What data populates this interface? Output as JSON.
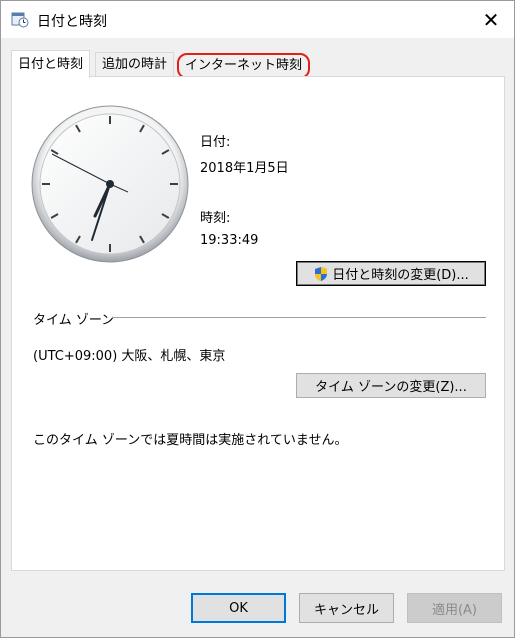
{
  "window": {
    "title": "日付と時刻",
    "close_glyph": "✕"
  },
  "tabs": [
    {
      "label": "日付と時刻",
      "active": true
    },
    {
      "label": "追加の時計",
      "active": false
    },
    {
      "label": "インターネット時刻",
      "active": false,
      "highlighted": true
    }
  ],
  "date_time": {
    "date_label": "日付:",
    "date_value": "2018年1月5日",
    "time_label": "時刻:",
    "time_value": "19:33:49",
    "change_button": "日付と時刻の変更(D)..."
  },
  "timezone": {
    "section_label": "タイム ゾーン",
    "value": "(UTC+09:00) 大阪、札幌、東京",
    "change_button": "タイム ゾーンの変更(Z)...",
    "dst_note": "このタイム ゾーンでは夏時間は実施されていません。"
  },
  "footer": {
    "ok": "OK",
    "cancel": "キャンセル",
    "apply": "適用(A)"
  },
  "colors": {
    "highlight_circle": "#e0201c",
    "default_button_border": "#0078d7"
  },
  "icons": {
    "title": "calendar-clock-icon",
    "shield": "uac-shield-icon"
  }
}
